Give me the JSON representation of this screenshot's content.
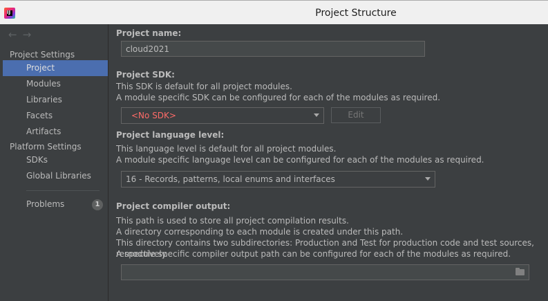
{
  "window": {
    "title": "Project Structure",
    "icon": "intellij-idea-icon"
  },
  "sidebar": {
    "nav_back": "←",
    "nav_forward": "→",
    "section_project_settings": "Project Settings",
    "project_items": [
      "Project",
      "Modules",
      "Libraries",
      "Facets",
      "Artifacts"
    ],
    "section_platform_settings": "Platform Settings",
    "platform_items": [
      "SDKs",
      "Global Libraries"
    ],
    "problems_label": "Problems",
    "problems_count": "1",
    "selected": "Project"
  },
  "content": {
    "project_name_label": "Project name:",
    "project_name_value": "cloud2021",
    "sdk_label": "Project SDK:",
    "sdk_desc1": "This SDK is default for all project modules.",
    "sdk_desc2": "A module specific SDK can be configured for each of the modules as required.",
    "sdk_value": "<No SDK>",
    "sdk_edit_button": "Edit",
    "lang_label": "Project language level:",
    "lang_desc1": "This language level is default for all project modules.",
    "lang_desc2": "A module specific language level can be configured for each of the modules as required.",
    "lang_value": "16 - Records, patterns, local enums and interfaces",
    "output_label": "Project compiler output:",
    "output_desc1": "This path is used to store all project compilation results.",
    "output_desc2": "A directory corresponding to each module is created under this path.",
    "output_desc3": "This directory contains two subdirectories: Production and Test for production code and test sources, respectively.",
    "output_desc4": "A module specific compiler output path can be configured for each of the modules as required.",
    "output_value": ""
  },
  "colors": {
    "background": "#3c3f41",
    "selection": "#4b6eaf",
    "error_text": "#ff6b68",
    "text": "#bbbbbb"
  }
}
